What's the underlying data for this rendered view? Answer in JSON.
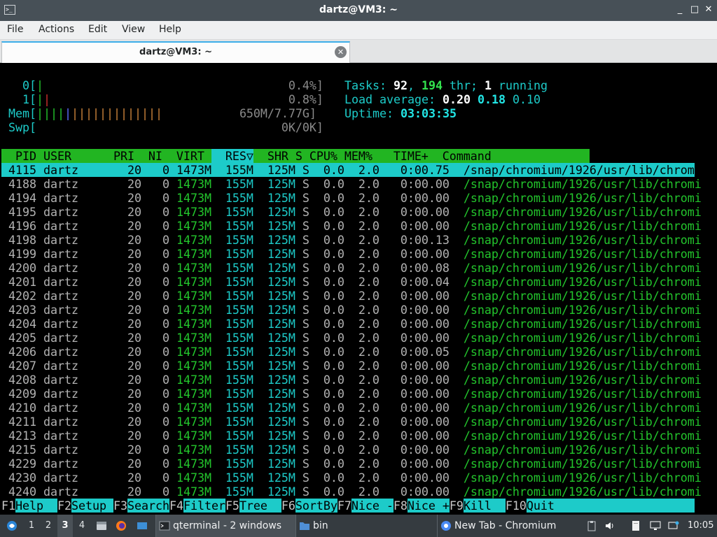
{
  "window": {
    "title": "dartz@VM3: ~",
    "app_icon": ">_",
    "controls": [
      "_",
      "□",
      "✕"
    ]
  },
  "menubar": {
    "items": [
      "File",
      "Actions",
      "Edit",
      "View",
      "Help"
    ]
  },
  "tab": {
    "label": "dartz@VM3: ~"
  },
  "htop": {
    "cpu0": {
      "label": "0[",
      "bar": "|",
      "value": "0.4%]"
    },
    "cpu1": {
      "label": "1[",
      "bar1": "|",
      "bar2": "|",
      "value": "0.8%]"
    },
    "mem": {
      "label": "Mem[",
      "value": "650M/7.77G]"
    },
    "swp": {
      "label": "Swp[",
      "value": "0K/0K]"
    },
    "tasks": {
      "label": "Tasks:",
      "count": "92",
      "thr": "194",
      "thr_label": "thr;",
      "running": "1",
      "running_label": "running"
    },
    "load": {
      "label": "Load average:",
      "v1": "0.20",
      "v2": "0.18",
      "v3": "0.10"
    },
    "uptime": {
      "label": "Uptime:",
      "value": "03:03:35"
    },
    "header": {
      "pre": "  PID USER      PRI  NI  VIRT ",
      "sort": "  RES▽",
      "post": "  SHR S CPU% MEM%   TIME+  Command"
    },
    "rows": [
      {
        "pid": "4115",
        "user": "dartz",
        "pri": "20",
        "ni": "0",
        "virt": "1473M",
        "res": "155M",
        "shr": "125M",
        "s": "S",
        "cpu": "0.0",
        "mem": "2.0",
        "time": "0:00.75",
        "cmd": "/snap/chromium/1926/usr/lib/chromi"
      },
      {
        "pid": "4188",
        "user": "dartz",
        "pri": "20",
        "ni": "0",
        "virt": "1473M",
        "res": "155M",
        "shr": "125M",
        "s": "S",
        "cpu": "0.0",
        "mem": "2.0",
        "time": "0:00.00",
        "cmd": "/snap/chromium/1926/usr/lib/chromi"
      },
      {
        "pid": "4194",
        "user": "dartz",
        "pri": "20",
        "ni": "0",
        "virt": "1473M",
        "res": "155M",
        "shr": "125M",
        "s": "S",
        "cpu": "0.0",
        "mem": "2.0",
        "time": "0:00.00",
        "cmd": "/snap/chromium/1926/usr/lib/chromi"
      },
      {
        "pid": "4195",
        "user": "dartz",
        "pri": "20",
        "ni": "0",
        "virt": "1473M",
        "res": "155M",
        "shr": "125M",
        "s": "S",
        "cpu": "0.0",
        "mem": "2.0",
        "time": "0:00.00",
        "cmd": "/snap/chromium/1926/usr/lib/chromi"
      },
      {
        "pid": "4196",
        "user": "dartz",
        "pri": "20",
        "ni": "0",
        "virt": "1473M",
        "res": "155M",
        "shr": "125M",
        "s": "S",
        "cpu": "0.0",
        "mem": "2.0",
        "time": "0:00.00",
        "cmd": "/snap/chromium/1926/usr/lib/chromi"
      },
      {
        "pid": "4198",
        "user": "dartz",
        "pri": "20",
        "ni": "0",
        "virt": "1473M",
        "res": "155M",
        "shr": "125M",
        "s": "S",
        "cpu": "0.0",
        "mem": "2.0",
        "time": "0:00.13",
        "cmd": "/snap/chromium/1926/usr/lib/chromi"
      },
      {
        "pid": "4199",
        "user": "dartz",
        "pri": "20",
        "ni": "0",
        "virt": "1473M",
        "res": "155M",
        "shr": "125M",
        "s": "S",
        "cpu": "0.0",
        "mem": "2.0",
        "time": "0:00.00",
        "cmd": "/snap/chromium/1926/usr/lib/chromi"
      },
      {
        "pid": "4200",
        "user": "dartz",
        "pri": "20",
        "ni": "0",
        "virt": "1473M",
        "res": "155M",
        "shr": "125M",
        "s": "S",
        "cpu": "0.0",
        "mem": "2.0",
        "time": "0:00.08",
        "cmd": "/snap/chromium/1926/usr/lib/chromi"
      },
      {
        "pid": "4201",
        "user": "dartz",
        "pri": "20",
        "ni": "0",
        "virt": "1473M",
        "res": "155M",
        "shr": "125M",
        "s": "S",
        "cpu": "0.0",
        "mem": "2.0",
        "time": "0:00.04",
        "cmd": "/snap/chromium/1926/usr/lib/chromi"
      },
      {
        "pid": "4202",
        "user": "dartz",
        "pri": "20",
        "ni": "0",
        "virt": "1473M",
        "res": "155M",
        "shr": "125M",
        "s": "S",
        "cpu": "0.0",
        "mem": "2.0",
        "time": "0:00.00",
        "cmd": "/snap/chromium/1926/usr/lib/chromi"
      },
      {
        "pid": "4203",
        "user": "dartz",
        "pri": "20",
        "ni": "0",
        "virt": "1473M",
        "res": "155M",
        "shr": "125M",
        "s": "S",
        "cpu": "0.0",
        "mem": "2.0",
        "time": "0:00.00",
        "cmd": "/snap/chromium/1926/usr/lib/chromi"
      },
      {
        "pid": "4204",
        "user": "dartz",
        "pri": "20",
        "ni": "0",
        "virt": "1473M",
        "res": "155M",
        "shr": "125M",
        "s": "S",
        "cpu": "0.0",
        "mem": "2.0",
        "time": "0:00.00",
        "cmd": "/snap/chromium/1926/usr/lib/chromi"
      },
      {
        "pid": "4205",
        "user": "dartz",
        "pri": "20",
        "ni": "0",
        "virt": "1473M",
        "res": "155M",
        "shr": "125M",
        "s": "S",
        "cpu": "0.0",
        "mem": "2.0",
        "time": "0:00.00",
        "cmd": "/snap/chromium/1926/usr/lib/chromi"
      },
      {
        "pid": "4206",
        "user": "dartz",
        "pri": "20",
        "ni": "0",
        "virt": "1473M",
        "res": "155M",
        "shr": "125M",
        "s": "S",
        "cpu": "0.0",
        "mem": "2.0",
        "time": "0:00.05",
        "cmd": "/snap/chromium/1926/usr/lib/chromi"
      },
      {
        "pid": "4207",
        "user": "dartz",
        "pri": "20",
        "ni": "0",
        "virt": "1473M",
        "res": "155M",
        "shr": "125M",
        "s": "S",
        "cpu": "0.0",
        "mem": "2.0",
        "time": "0:00.00",
        "cmd": "/snap/chromium/1926/usr/lib/chromi"
      },
      {
        "pid": "4208",
        "user": "dartz",
        "pri": "20",
        "ni": "0",
        "virt": "1473M",
        "res": "155M",
        "shr": "125M",
        "s": "S",
        "cpu": "0.0",
        "mem": "2.0",
        "time": "0:00.00",
        "cmd": "/snap/chromium/1926/usr/lib/chromi"
      },
      {
        "pid": "4209",
        "user": "dartz",
        "pri": "20",
        "ni": "0",
        "virt": "1473M",
        "res": "155M",
        "shr": "125M",
        "s": "S",
        "cpu": "0.0",
        "mem": "2.0",
        "time": "0:00.00",
        "cmd": "/snap/chromium/1926/usr/lib/chromi"
      },
      {
        "pid": "4210",
        "user": "dartz",
        "pri": "20",
        "ni": "0",
        "virt": "1473M",
        "res": "155M",
        "shr": "125M",
        "s": "S",
        "cpu": "0.0",
        "mem": "2.0",
        "time": "0:00.00",
        "cmd": "/snap/chromium/1926/usr/lib/chromi"
      },
      {
        "pid": "4211",
        "user": "dartz",
        "pri": "20",
        "ni": "0",
        "virt": "1473M",
        "res": "155M",
        "shr": "125M",
        "s": "S",
        "cpu": "0.0",
        "mem": "2.0",
        "time": "0:00.00",
        "cmd": "/snap/chromium/1926/usr/lib/chromi"
      },
      {
        "pid": "4213",
        "user": "dartz",
        "pri": "20",
        "ni": "0",
        "virt": "1473M",
        "res": "155M",
        "shr": "125M",
        "s": "S",
        "cpu": "0.0",
        "mem": "2.0",
        "time": "0:00.00",
        "cmd": "/snap/chromium/1926/usr/lib/chromi"
      },
      {
        "pid": "4215",
        "user": "dartz",
        "pri": "20",
        "ni": "0",
        "virt": "1473M",
        "res": "155M",
        "shr": "125M",
        "s": "S",
        "cpu": "0.0",
        "mem": "2.0",
        "time": "0:00.00",
        "cmd": "/snap/chromium/1926/usr/lib/chromi"
      },
      {
        "pid": "4229",
        "user": "dartz",
        "pri": "20",
        "ni": "0",
        "virt": "1473M",
        "res": "155M",
        "shr": "125M",
        "s": "S",
        "cpu": "0.0",
        "mem": "2.0",
        "time": "0:00.00",
        "cmd": "/snap/chromium/1926/usr/lib/chromi"
      },
      {
        "pid": "4230",
        "user": "dartz",
        "pri": "20",
        "ni": "0",
        "virt": "1473M",
        "res": "155M",
        "shr": "125M",
        "s": "S",
        "cpu": "0.0",
        "mem": "2.0",
        "time": "0:00.00",
        "cmd": "/snap/chromium/1926/usr/lib/chromi"
      },
      {
        "pid": "4240",
        "user": "dartz",
        "pri": "20",
        "ni": "0",
        "virt": "1473M",
        "res": "155M",
        "shr": "125M",
        "s": "S",
        "cpu": "0.0",
        "mem": "2.0",
        "time": "0:00.00",
        "cmd": "/snap/chromium/1926/usr/lib/chromi"
      }
    ],
    "fkeys": [
      {
        "key": "F1",
        "label": "Help  "
      },
      {
        "key": "F2",
        "label": "Setup "
      },
      {
        "key": "F3",
        "label": "Search"
      },
      {
        "key": "F4",
        "label": "Filter"
      },
      {
        "key": "F5",
        "label": "Tree  "
      },
      {
        "key": "F6",
        "label": "SortBy"
      },
      {
        "key": "F7",
        "label": "Nice -"
      },
      {
        "key": "F8",
        "label": "Nice +"
      },
      {
        "key": "F9",
        "label": "Kill  "
      },
      {
        "key": "F10",
        "label": "Quit"
      }
    ]
  },
  "taskbar": {
    "workspaces": [
      "1",
      "2",
      "3",
      "4"
    ],
    "active_workspace": "3",
    "tasks": [
      {
        "label": "qterminal - 2 windows",
        "icon": "terminal-icon"
      },
      {
        "label": "bin",
        "icon": "folder-icon"
      },
      {
        "label": "New Tab - Chromium",
        "icon": "chromium-icon"
      }
    ],
    "clock": "10:05"
  },
  "colors": {
    "green": "#23c52c",
    "cyan": "#1dcbc9",
    "titlebar": "#475057",
    "taskbar": "#353b40"
  }
}
